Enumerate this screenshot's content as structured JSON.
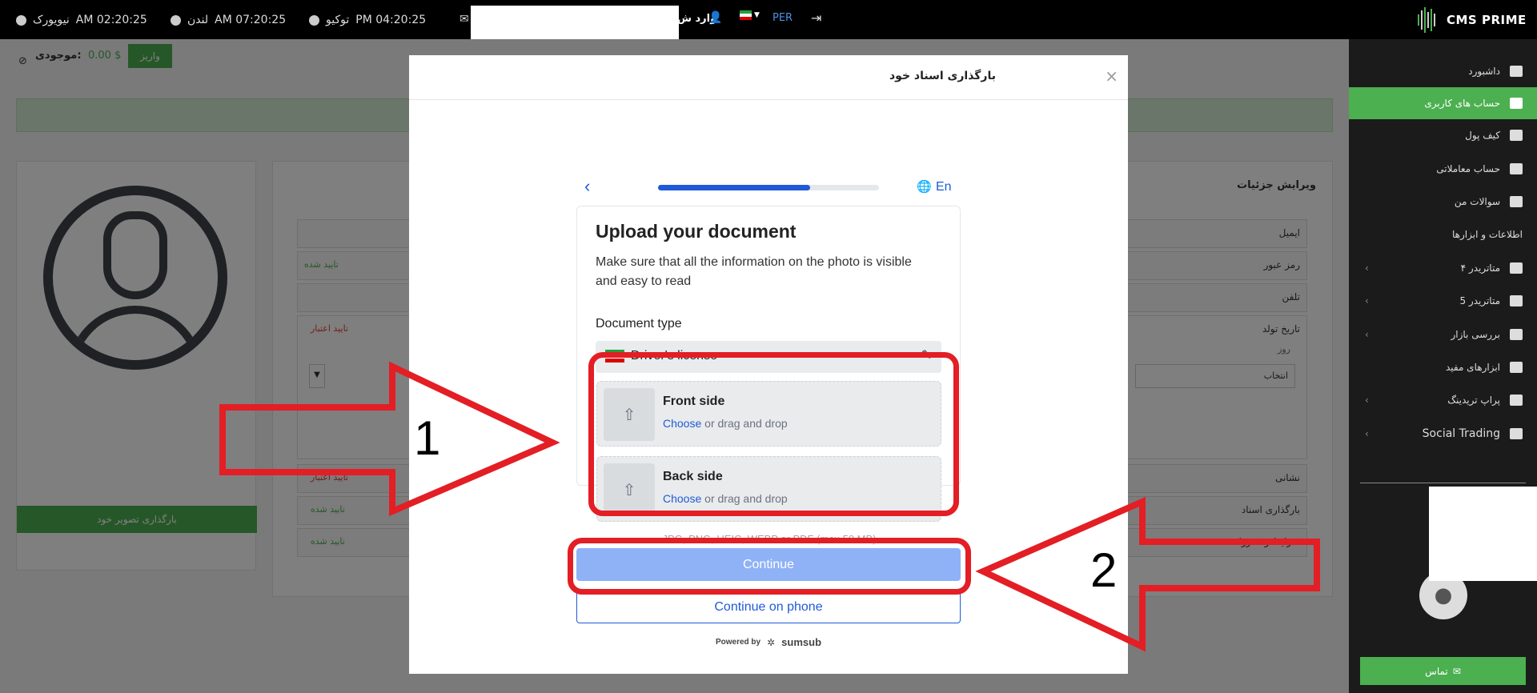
{
  "topbar": {
    "clocks": [
      {
        "city": "نیویورک",
        "time": "AM 02:20:25"
      },
      {
        "city": "لندن",
        "time": "AM 07:20:25"
      },
      {
        "city": "توکیو",
        "time": "PM 04:20:25"
      }
    ],
    "login_label": "وارد ش",
    "lang": "PER",
    "brand": "CMS PRIME"
  },
  "account_bar": {
    "balance_label": "موجودی:",
    "balance": "0.00 $",
    "deposit": "واریز"
  },
  "profile": {
    "upload_photo": "بارگذاری تصویر خود"
  },
  "details": {
    "title": "ویرایش جزئیات",
    "rows": [
      "ایمیل",
      "رمز عبور",
      "تلفن",
      "تاریخ تولد",
      "نشانی",
      "بارگذاری اسناد",
      "شرایط و مقررات"
    ],
    "verified": "تایید شده",
    "invalid": "تایید اعتبار",
    "day_label": "روز",
    "select_label": "انتخاب"
  },
  "sidebar": {
    "items": [
      "داشبورد",
      "حساب های کاربری",
      "کیف پول",
      "حساب معاملاتی",
      "سوالات من",
      "اطلاعات و ابزارها",
      "متاتریدر ۴",
      "متاتریدر 5",
      "بررسی بازار",
      "ابزارهای مفید",
      "پراپ تریدینگ",
      "Social Trading"
    ],
    "contact": "تماس"
  },
  "modal": {
    "title": "بارگذاری اسناد خود",
    "lang": "En",
    "progress": 0.69,
    "heading": "Upload your document",
    "desc_line1": "Make sure that all the information on the photo is visible",
    "desc_line2": "and easy to read",
    "doc_type_label": "Document type",
    "doc_type_value": "Driver's license",
    "front_title": "Front side",
    "back_title": "Back side",
    "choose": "Choose",
    "drag": " or drag and drop",
    "formats": "JPG, PNG, HEIC, WEBP or PDF (max 50 MB)",
    "continue": "Continue",
    "continue_phone": "Continue on phone",
    "powered_by": "Powered by",
    "sumsub": "sumsub"
  },
  "annotations": {
    "label1": "1",
    "label2": "2"
  },
  "colors": {
    "accent_green": "#4caf50",
    "sumsub_blue": "#1f5ad8",
    "red_annotation": "#e31e24"
  }
}
